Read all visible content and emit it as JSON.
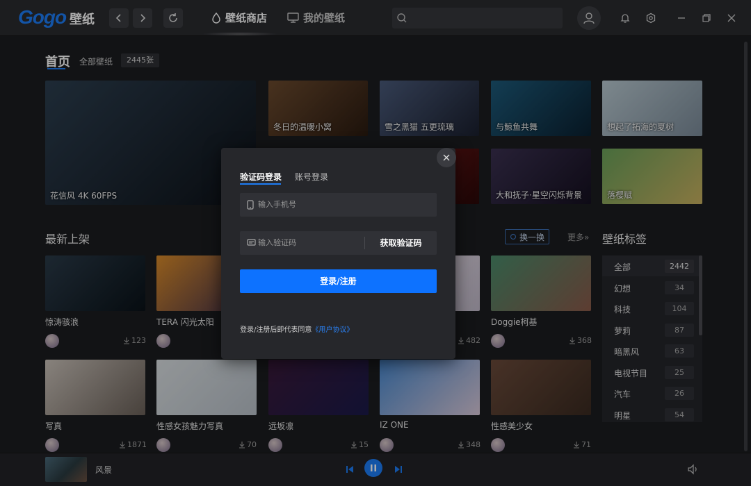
{
  "app": {
    "logo_text": "Gogo",
    "logo_cn": "壁纸",
    "nav_tabs": [
      {
        "label": "壁纸商店",
        "active": true
      },
      {
        "label": "我的壁纸",
        "active": false
      }
    ],
    "search_placeholder": ""
  },
  "home": {
    "title": "首页",
    "subnav_label": "全部壁纸",
    "count_badge": "2445张"
  },
  "featured": [
    {
      "title": "花信风 4K 60FPS",
      "colors": [
        "#2c3e4f",
        "#0d1117"
      ]
    },
    {
      "title": "冬日的温暖小窝",
      "colors": [
        "#6b4a2e",
        "#2a1a10"
      ]
    },
    {
      "title": "雪之黑猫 五更琉璃",
      "colors": [
        "#4a5a7a",
        "#1a1f2e"
      ]
    },
    {
      "title": "与鲸鱼共舞",
      "colors": [
        "#1d5a7a",
        "#0a2030"
      ]
    },
    {
      "title": "想起了拓海的夏树",
      "colors": [
        "#b8c8d0",
        "#7a8a98"
      ]
    },
    {
      "title": "",
      "colors": [
        "#7a1a1a",
        "#2a0808"
      ]
    },
    {
      "title": "大和抚子·星空闪烁背景",
      "colors": [
        "#3a3050",
        "#151020"
      ]
    },
    {
      "title": "落樱赋",
      "colors": [
        "#6aa05a",
        "#c8b060"
      ]
    }
  ],
  "latest": {
    "title": "最新上架",
    "refresh_label": "换一换",
    "more_label": "更多»",
    "items": [
      {
        "title": "惊涛骇浪",
        "downloads": "123",
        "colors": [
          "#2a3a48",
          "#0a1218"
        ]
      },
      {
        "title": "TERA 闪光太阳",
        "downloads": "",
        "colors": [
          "#d88a2a",
          "#3a2a4a"
        ]
      },
      {
        "title": "",
        "downloads": "",
        "colors": [
          "#2a2a2a",
          "#1a1a1a"
        ]
      },
      {
        "title": "",
        "downloads": "482",
        "colors": [
          "#e8e0e8",
          "#c0b8c8"
        ]
      },
      {
        "title": "Doggie柯基",
        "downloads": "368",
        "colors": [
          "#4a8a6a",
          "#8a5a4a"
        ]
      },
      {
        "title": "写真",
        "downloads": "1871",
        "colors": [
          "#c8c0b8",
          "#6a6058"
        ]
      },
      {
        "title": "性感女孩魅力写真",
        "downloads": "70",
        "colors": [
          "#d8dde0",
          "#b8c0c8"
        ]
      },
      {
        "title": "远坂凛",
        "downloads": "15",
        "colors": [
          "#3a1a3a",
          "#1a1a4a"
        ]
      },
      {
        "title": "IZ ONE",
        "downloads": "348",
        "colors": [
          "#4a8ad0",
          "#d8c8d8"
        ]
      },
      {
        "title": "性感美少女",
        "downloads": "71",
        "colors": [
          "#6a4a3a",
          "#3a2a20"
        ]
      }
    ]
  },
  "tags": {
    "title": "壁纸标签",
    "items": [
      {
        "label": "全部",
        "count": "2442"
      },
      {
        "label": "幻想",
        "count": "34"
      },
      {
        "label": "科技",
        "count": "104"
      },
      {
        "label": "萝莉",
        "count": "87"
      },
      {
        "label": "暗黑风",
        "count": "63"
      },
      {
        "label": "电视节目",
        "count": "25"
      },
      {
        "label": "汽车",
        "count": "26"
      },
      {
        "label": "明星",
        "count": "54"
      }
    ]
  },
  "player": {
    "title": "风景"
  },
  "login_modal": {
    "tab_sms": "验证码登录",
    "tab_account": "账号登录",
    "phone_placeholder": "输入手机号",
    "code_placeholder": "输入验证码",
    "get_code_label": "获取验证码",
    "submit_label": "登录/注册",
    "agreement_text": "登录/注册后即代表同意",
    "agreement_link": "《用户协议》"
  },
  "colors": {
    "accent": "#1d7cf5",
    "button": "#0d72ff"
  }
}
